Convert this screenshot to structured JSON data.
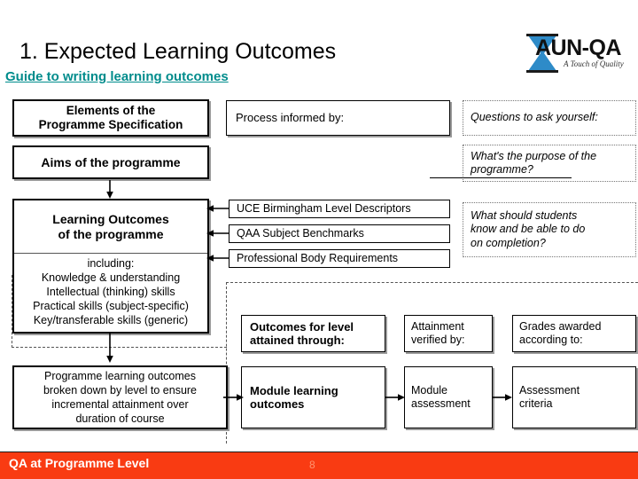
{
  "slide": {
    "title": "1. Expected Learning Outcomes",
    "guide_link": "Guide to writing learning outcomes"
  },
  "logo": {
    "name": "AUN-QA",
    "tagline": "A Touch of Quality",
    "mark_icon": "hourglass-icon",
    "mark_color": "#2E8BC8"
  },
  "diagram": {
    "column_headers": {
      "elements": "Elements of the\nProgramme Specification",
      "process": "Process informed by:",
      "questions": "Questions to ask yourself:"
    },
    "boxes": {
      "elements_title_line1": "Elements of the",
      "elements_title_line2": "Programme Specification",
      "aims": "Aims of the programme",
      "process_informed_by": "Process informed by:",
      "questions_to_ask": "Questions to ask yourself:",
      "purpose_question": "What's the purpose of the\nprogramme?",
      "learning_outcomes_line1": "Learning Outcomes",
      "learning_outcomes_line2": "of the programme",
      "including_label": "including:",
      "including_items": [
        "Knowledge & understanding",
        "Intellectual (thinking) skills",
        "Practical skills (subject-specific)",
        "Key/transferable skills (generic)"
      ],
      "level_descriptors": "UCE Birmingham Level Descriptors",
      "subject_benchmarks": "QAA Subject Benchmarks",
      "professional_body": "Professional Body Requirements",
      "students_question": "What should students\nknow and be able to do\non completion?",
      "broken_down": "Programme learning outcomes\nbroken down by level to ensure\nincremental attainment over\nduration of course",
      "outcomes_for_level": "Outcomes for level\nattained through:",
      "attainment_verified": "Attainment\nverified by:",
      "grades_awarded": "Grades awarded\naccording to:",
      "module_learning_outcomes": "Module learning\noutcomes",
      "module_assessment": "Module\nassessment",
      "assessment_criteria": "Assessment\ncriteria"
    }
  },
  "footer": {
    "title": "QA at Programme Level",
    "page_number": "8",
    "bar_color": "#F93B12"
  }
}
